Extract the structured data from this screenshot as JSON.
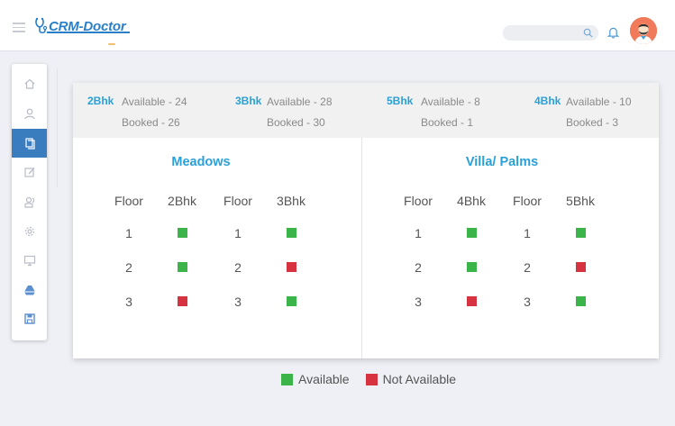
{
  "app": {
    "logo_text": "CRM-Doctor"
  },
  "colors": {
    "available": "#3bb54a",
    "not_available": "#d6323f",
    "accent": "#2aa0d8",
    "sidebar_active": "#3a7dbf"
  },
  "sidebar": {
    "items": [
      {
        "icon": "home-icon",
        "active": false
      },
      {
        "icon": "user-icon",
        "active": false
      },
      {
        "icon": "documents-icon",
        "active": true
      },
      {
        "icon": "edit-icon",
        "active": false
      },
      {
        "icon": "users-icon",
        "active": false
      },
      {
        "icon": "settings-icon",
        "active": false
      },
      {
        "icon": "monitor-icon",
        "active": false
      },
      {
        "icon": "drive-icon",
        "active": false
      },
      {
        "icon": "save-icon",
        "active": false
      }
    ]
  },
  "summary": [
    {
      "type": "2Bhk",
      "available": "Available - 24",
      "booked": "Booked - 26"
    },
    {
      "type": "3Bhk",
      "available": "Available - 28",
      "booked": "Booked - 30"
    },
    {
      "type": "5Bhk",
      "available": "Available - 8",
      "booked": "Booked - 1"
    },
    {
      "type": "4Bhk",
      "available": "Available - 10",
      "booked": "Booked - 3"
    }
  ],
  "panels": [
    {
      "title": "Meadows",
      "headers": [
        "Floor",
        "2Bhk",
        "Floor",
        "3Bhk"
      ],
      "rows": [
        {
          "floor_a": "1",
          "status_a": "available",
          "floor_b": "1",
          "status_b": "available"
        },
        {
          "floor_a": "2",
          "status_a": "available",
          "floor_b": "2",
          "status_b": "not_available"
        },
        {
          "floor_a": "3",
          "status_a": "not_available",
          "floor_b": "3",
          "status_b": "available"
        }
      ]
    },
    {
      "title": "Villa/ Palms",
      "headers": [
        "Floor",
        "4Bhk",
        "Floor",
        "5Bhk"
      ],
      "rows": [
        {
          "floor_a": "1",
          "status_a": "available",
          "floor_b": "1",
          "status_b": "available"
        },
        {
          "floor_a": "2",
          "status_a": "available",
          "floor_b": "2",
          "status_b": "not_available"
        },
        {
          "floor_a": "3",
          "status_a": "not_available",
          "floor_b": "3",
          "status_b": "available"
        }
      ]
    }
  ],
  "legend": {
    "available": "Available",
    "not_available": "Not Available"
  }
}
